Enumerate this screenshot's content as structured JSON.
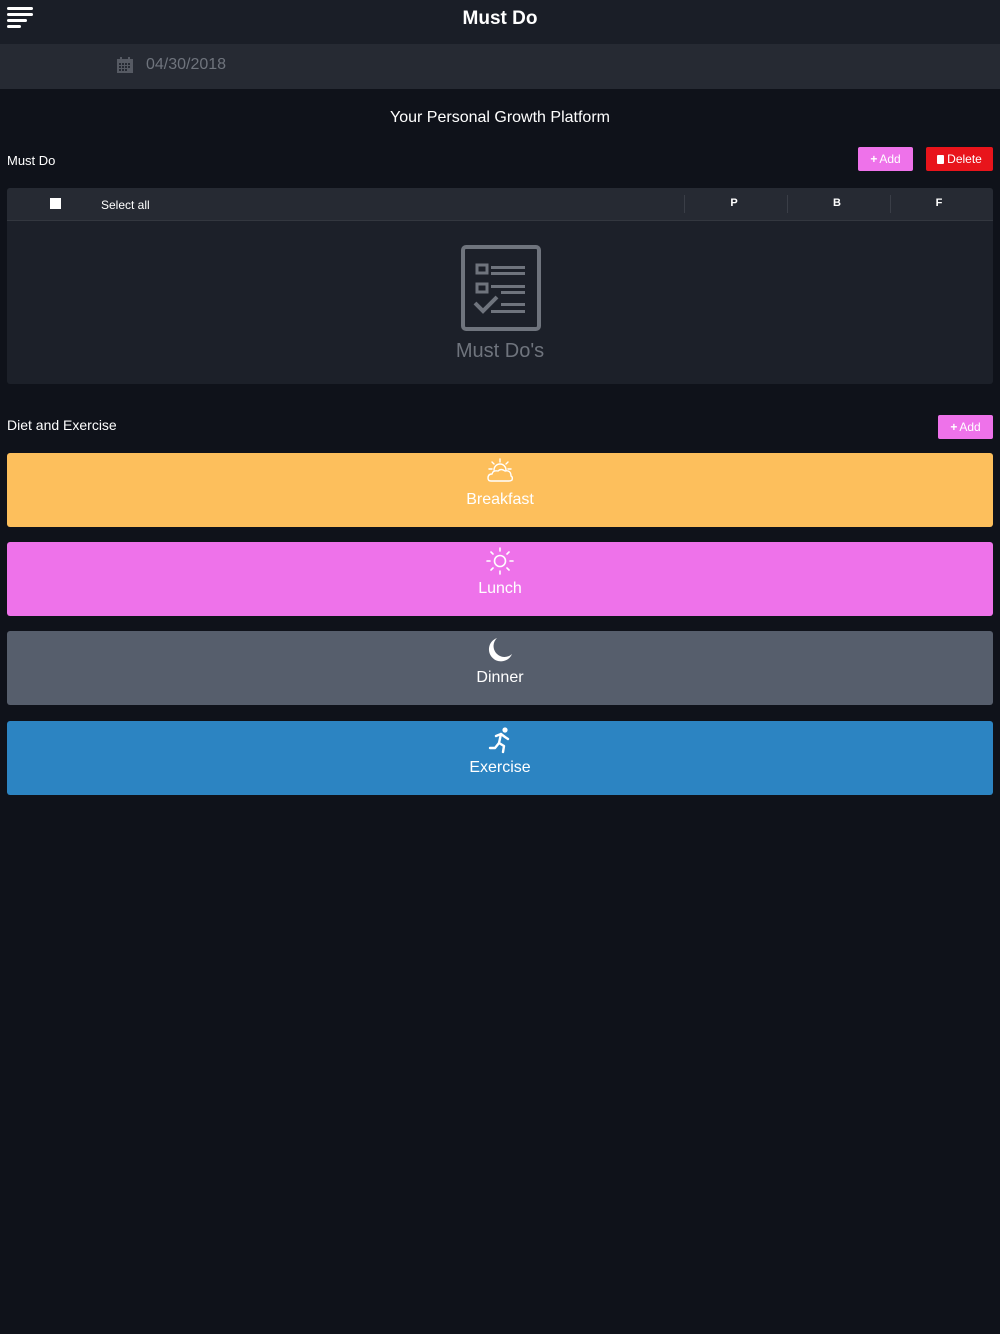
{
  "header": {
    "title": "Must Do",
    "menu_icon": "hamburger-menu-icon"
  },
  "date_bar": {
    "icon": "calendar-icon",
    "date": "04/30/2018"
  },
  "tagline": "Your Personal Growth Platform",
  "must_do": {
    "label": "Must Do",
    "add_label": "Add",
    "delete_label": "Delete",
    "table": {
      "select_all": "Select all",
      "columns": [
        "P",
        "B",
        "F"
      ],
      "empty_text": "Must Do's",
      "empty_icon": "checklist-icon"
    }
  },
  "diet_exercise": {
    "label": "Diet and Exercise",
    "add_label": "Add",
    "items": [
      {
        "label": "Breakfast",
        "icon": "sun-cloud-icon",
        "color": "#fdbf5c"
      },
      {
        "label": "Lunch",
        "icon": "sun-icon",
        "color": "#ee72ea"
      },
      {
        "label": "Dinner",
        "icon": "moon-icon",
        "color": "#565e6c"
      },
      {
        "label": "Exercise",
        "icon": "runner-icon",
        "color": "#2c84c2"
      }
    ]
  },
  "colors": {
    "background": "#0f121a",
    "header": "#1a1e27",
    "add_button": "#ee72ea",
    "delete_button": "#e8141b"
  }
}
